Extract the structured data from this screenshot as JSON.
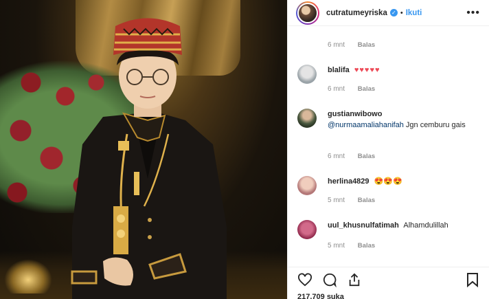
{
  "header": {
    "username": "cutratumeyriska",
    "separator": "•",
    "follow_label": "Ikuti",
    "more_label": "•••"
  },
  "comments": {
    "top_meta": {
      "time": "6 mnt",
      "reply": "Balas"
    },
    "items": [
      {
        "user": "blalifa",
        "text": "♥♥♥♥♥",
        "time": "6 mnt",
        "reply": "Balas",
        "avatar_color": "#bfbfbf"
      },
      {
        "user": "gustianwibowo",
        "mention": "@nurmaamaliahanifah",
        "text": " Jgn cemburu gais",
        "time": "6 mnt",
        "reply": "Balas",
        "avatar_color": "#5a6b4e"
      },
      {
        "user": "herlina4829",
        "text": "😍😍😍",
        "time": "5 mnt",
        "reply": "Balas",
        "avatar_color": "#c98a8a"
      },
      {
        "user": "uul_khusnulfatimah",
        "text": "Alhamdulillah",
        "time": "5 mnt",
        "reply": "Balas",
        "avatar_color": "#b5456a"
      }
    ]
  },
  "actions": {
    "icons": [
      "heart-icon",
      "comment-icon",
      "share-icon",
      "bookmark-icon"
    ]
  },
  "likes": "217.709 suka",
  "colors": {
    "accent": "#3897f0",
    "text": "#262626",
    "muted": "#8e8e8e",
    "heart": "#ed4956"
  }
}
